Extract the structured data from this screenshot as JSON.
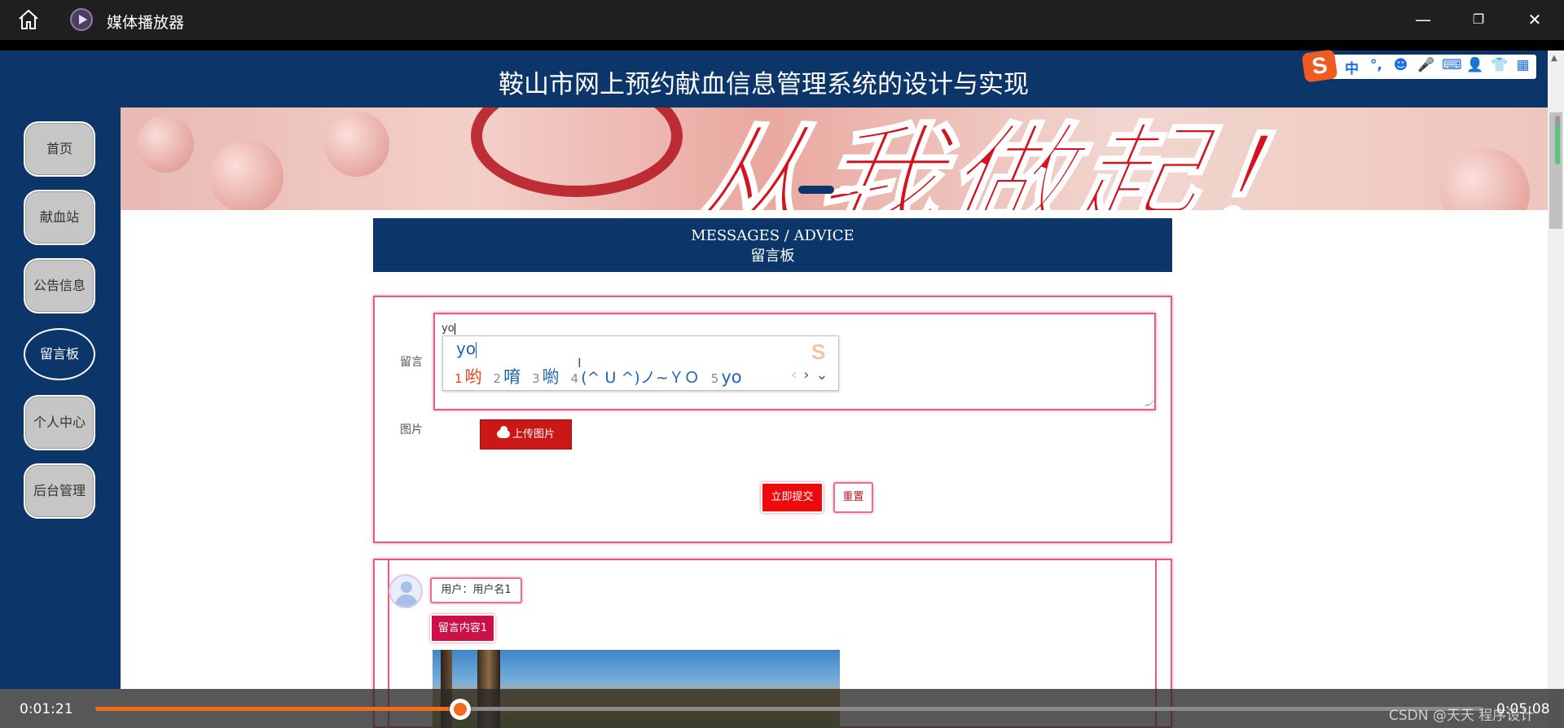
{
  "player": {
    "title": "媒体播放器",
    "current_time": "0:01:21",
    "total_time": "0:05:08",
    "progress_fraction": 0.263,
    "watermark": "CSDN @天天 程序设计"
  },
  "site": {
    "title": "鞍山市网上预约献血信息管理系统的设计与实现",
    "banner_text": "从我做起！"
  },
  "sidebar": {
    "items": [
      {
        "label": "首页",
        "active": false
      },
      {
        "label": "献血站",
        "active": false
      },
      {
        "label": "公告信息",
        "active": false
      },
      {
        "label": "留言板",
        "active": true
      },
      {
        "label": "个人中心",
        "active": false
      },
      {
        "label": "后台管理",
        "active": false
      }
    ]
  },
  "section": {
    "title_en": "MESSAGES / ADVICE",
    "title_cn": "留言板"
  },
  "form": {
    "message_label": "留言",
    "message_value": "yo",
    "image_label": "图片",
    "upload_label": "上传图片",
    "submit_label": "立即提交",
    "reset_label": "重置"
  },
  "ime": {
    "composition": "yo",
    "candidates": [
      {
        "num": "1",
        "text": "哟"
      },
      {
        "num": "2",
        "text": "唷"
      },
      {
        "num": "3",
        "text": "喲"
      },
      {
        "num": "4",
        "text": "(^ U ^)ノ~ＹＯ"
      },
      {
        "num": "5",
        "text": "yo"
      }
    ],
    "toolbar_icons": [
      "zh-mode-icon",
      "punctuation-icon",
      "emoji-icon",
      "microphone-icon",
      "keyboard-icon",
      "user-icon",
      "skin-icon",
      "toolbox-icon"
    ],
    "zh_label": "中",
    "punct_label": "°,"
  },
  "messages": [
    {
      "user_label": "用户：用户名1",
      "content": "留言内容1"
    }
  ],
  "colors": {
    "brand_navy": "#0c3569",
    "accent_red": "#ee0a0a",
    "border_pink": "#e8598a",
    "progress_orange": "#f36a1b"
  }
}
